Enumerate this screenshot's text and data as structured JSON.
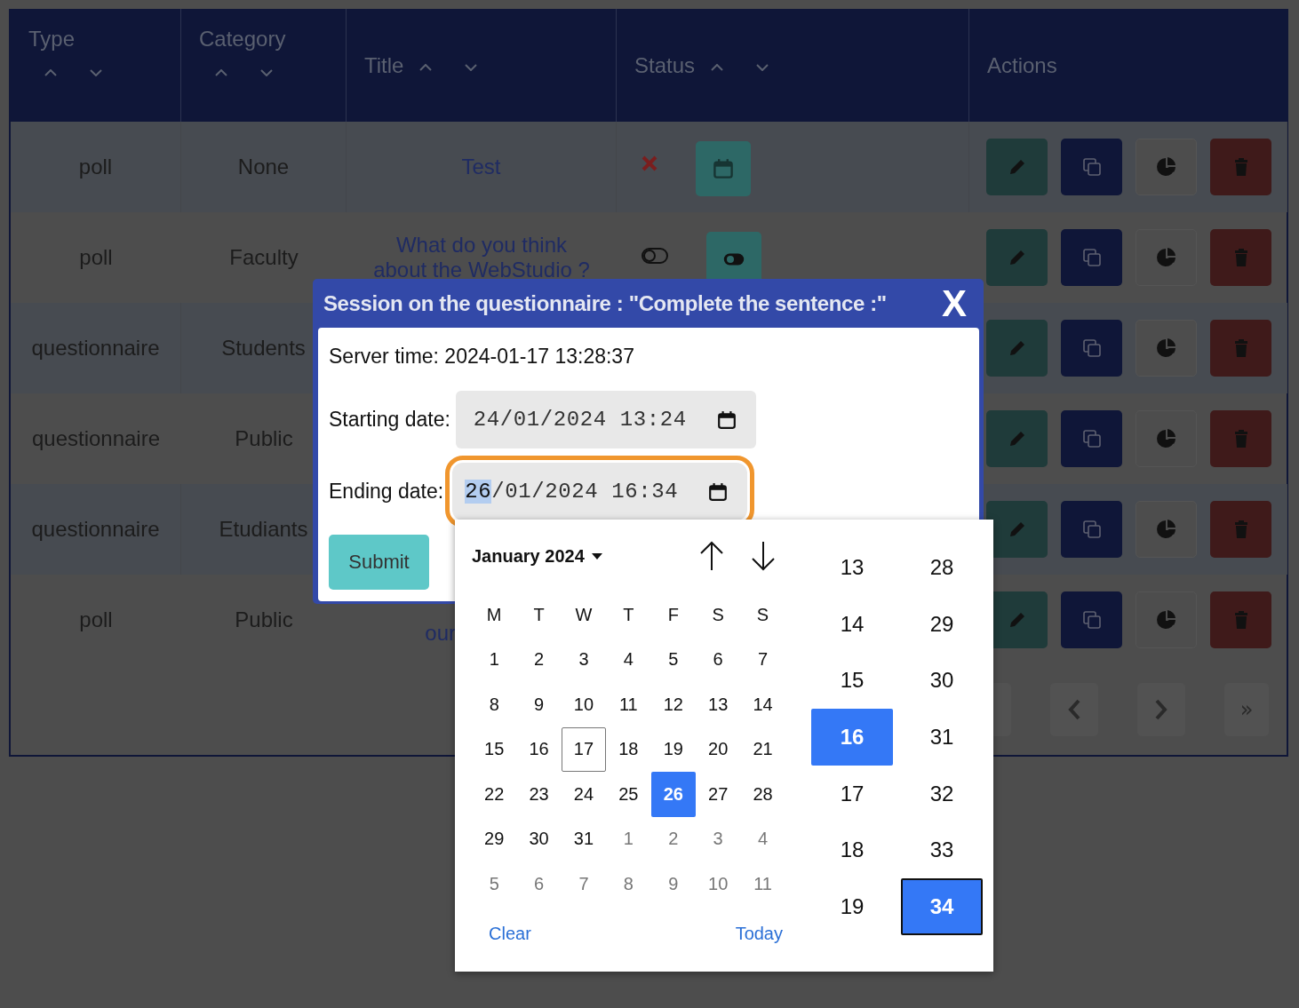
{
  "table": {
    "columns": [
      {
        "label": "Type",
        "kind": "below"
      },
      {
        "label": "Category",
        "kind": "below"
      },
      {
        "label": "Title",
        "kind": "inline"
      },
      {
        "label": "Status",
        "kind": "inline"
      },
      {
        "label": "Actions",
        "kind": "plain"
      }
    ],
    "rows": [
      {
        "type": "poll",
        "category": "None",
        "title": [
          "Test"
        ],
        "status": {
          "kind": "scheduled"
        },
        "clipped": false
      },
      {
        "type": "poll",
        "category": "Faculty",
        "title": [
          "What do you think",
          "about the WebStudio ?"
        ],
        "status": {
          "kind": "toggle"
        },
        "clipped": false
      },
      {
        "type": "questionnaire",
        "category": "Students"
      },
      {
        "type": "questionnaire",
        "category": "Public"
      },
      {
        "type": "questionnaire",
        "category": "Etudiants"
      },
      {
        "type": "poll",
        "category": "Public",
        "title": [
          "our"
        ],
        "clipped": true
      }
    ]
  },
  "pagination": {
    "last": "»"
  },
  "modal": {
    "title": "Session on the questionnaire : \"Complete the sentence :\"",
    "close": "X",
    "server_time": "Server time: 2024-01-17 13:28:37",
    "fields": [
      {
        "label": "Starting date:",
        "day": "24",
        "rest": "/01/2024 13:24",
        "focused": false
      },
      {
        "label": "Ending date:",
        "day": "26",
        "rest": "/01/2024 16:34",
        "focused": true
      }
    ],
    "submit": "Submit"
  },
  "picker": {
    "month": "January 2024",
    "weekdays": [
      "M",
      "T",
      "W",
      "T",
      "F",
      "S",
      "S"
    ],
    "weeks": [
      [
        {
          "label": "1",
          "in_month": true,
          "today": false,
          "selected": false
        },
        {
          "label": "2",
          "in_month": true,
          "today": false,
          "selected": false
        },
        {
          "label": "3",
          "in_month": true,
          "today": false,
          "selected": false
        },
        {
          "label": "4",
          "in_month": true,
          "today": false,
          "selected": false
        },
        {
          "label": "5",
          "in_month": true,
          "today": false,
          "selected": false
        },
        {
          "label": "6",
          "in_month": true,
          "today": false,
          "selected": false
        },
        {
          "label": "7",
          "in_month": true,
          "today": false,
          "selected": false
        }
      ],
      [
        {
          "label": "8",
          "in_month": true,
          "today": false,
          "selected": false
        },
        {
          "label": "9",
          "in_month": true,
          "today": false,
          "selected": false
        },
        {
          "label": "10",
          "in_month": true,
          "today": false,
          "selected": false
        },
        {
          "label": "11",
          "in_month": true,
          "today": false,
          "selected": false
        },
        {
          "label": "12",
          "in_month": true,
          "today": false,
          "selected": false
        },
        {
          "label": "13",
          "in_month": true,
          "today": false,
          "selected": false
        },
        {
          "label": "14",
          "in_month": true,
          "today": false,
          "selected": false
        }
      ],
      [
        {
          "label": "15",
          "in_month": true,
          "today": false,
          "selected": false
        },
        {
          "label": "16",
          "in_month": true,
          "today": false,
          "selected": false
        },
        {
          "label": "17",
          "in_month": true,
          "today": true,
          "selected": false
        },
        {
          "label": "18",
          "in_month": true,
          "today": false,
          "selected": false
        },
        {
          "label": "19",
          "in_month": true,
          "today": false,
          "selected": false
        },
        {
          "label": "20",
          "in_month": true,
          "today": false,
          "selected": false
        },
        {
          "label": "21",
          "in_month": true,
          "today": false,
          "selected": false
        }
      ],
      [
        {
          "label": "22",
          "in_month": true,
          "today": false,
          "selected": false
        },
        {
          "label": "23",
          "in_month": true,
          "today": false,
          "selected": false
        },
        {
          "label": "24",
          "in_month": true,
          "today": false,
          "selected": false
        },
        {
          "label": "25",
          "in_month": true,
          "today": false,
          "selected": false
        },
        {
          "label": "26",
          "in_month": true,
          "today": false,
          "selected": true
        },
        {
          "label": "27",
          "in_month": true,
          "today": false,
          "selected": false
        },
        {
          "label": "28",
          "in_month": true,
          "today": false,
          "selected": false
        }
      ],
      [
        {
          "label": "29",
          "in_month": true,
          "today": false,
          "selected": false
        },
        {
          "label": "30",
          "in_month": true,
          "today": false,
          "selected": false
        },
        {
          "label": "31",
          "in_month": true,
          "today": false,
          "selected": false
        },
        {
          "label": "1",
          "in_month": false,
          "today": false,
          "selected": false
        },
        {
          "label": "2",
          "in_month": false,
          "today": false,
          "selected": false
        },
        {
          "label": "3",
          "in_month": false,
          "today": false,
          "selected": false
        },
        {
          "label": "4",
          "in_month": false,
          "today": false,
          "selected": false
        }
      ],
      [
        {
          "label": "5",
          "in_month": false,
          "today": false,
          "selected": false
        },
        {
          "label": "6",
          "in_month": false,
          "today": false,
          "selected": false
        },
        {
          "label": "7",
          "in_month": false,
          "today": false,
          "selected": false
        },
        {
          "label": "8",
          "in_month": false,
          "today": false,
          "selected": false
        },
        {
          "label": "9",
          "in_month": false,
          "today": false,
          "selected": false
        },
        {
          "label": "10",
          "in_month": false,
          "today": false,
          "selected": false
        },
        {
          "label": "11",
          "in_month": false,
          "today": false,
          "selected": false
        }
      ]
    ],
    "hours": [
      {
        "label": "13",
        "selected": false
      },
      {
        "label": "14",
        "selected": false
      },
      {
        "label": "15",
        "selected": false
      },
      {
        "label": "16",
        "selected": true
      },
      {
        "label": "17",
        "selected": false
      },
      {
        "label": "18",
        "selected": false
      },
      {
        "label": "19",
        "selected": false
      }
    ],
    "minutes": [
      {
        "label": "28",
        "selected": false,
        "focused": false
      },
      {
        "label": "29",
        "selected": false,
        "focused": false
      },
      {
        "label": "30",
        "selected": false,
        "focused": false
      },
      {
        "label": "31",
        "selected": false,
        "focused": false
      },
      {
        "label": "32",
        "selected": false,
        "focused": false
      },
      {
        "label": "33",
        "selected": false,
        "focused": false
      },
      {
        "label": "34",
        "selected": true,
        "focused": true
      }
    ],
    "clear": "Clear",
    "today": "Today"
  }
}
